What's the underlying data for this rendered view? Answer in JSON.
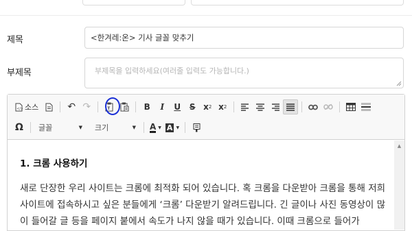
{
  "form": {
    "title_label": "제목",
    "title_value": "<한겨레:온> 기사 글꼴 맞추기",
    "subtitle_label": "부제목",
    "subtitle_placeholder": "부제목을 입력하세요(여러줄 입력도 가능합니다.)"
  },
  "toolbar": {
    "source_label": "소스",
    "font_combo_label": "글꼴",
    "size_combo_label": "크기",
    "font_color_glyph": "A",
    "bg_color_glyph": "A",
    "bold_glyph": "B",
    "italic_glyph": "I",
    "underline_glyph": "U",
    "strike_glyph": "S",
    "subscript_glyph": "x",
    "subscript_mark": "2",
    "superscript_glyph": "x",
    "superscript_mark": "2",
    "special_char_glyph": "Ω",
    "undo_glyph": "↶",
    "redo_glyph": "↷"
  },
  "content": {
    "heading": "1. 크롬 사용하기",
    "paragraph": "새로 단장한 우리 사이트는 크롬에 최적화 되어 있습니다. 혹 크롬을 다운받아 크롬을 통해 저희 사이트에 접속하시고 싶은 분들에게 ‘크롬’ 다운받기 알려드립니다. 긴 글이나 사진 동영상이 많이 들어갈 글 등을 페이지 붙에서 속도가 나지 않을 때가 있습니다. 이때 크롬으로 들어가"
  },
  "colors": {
    "highlight_circle": "#1a2fd6",
    "toolbar_bg": "#f8f8f8",
    "border": "#d1d1d1"
  }
}
